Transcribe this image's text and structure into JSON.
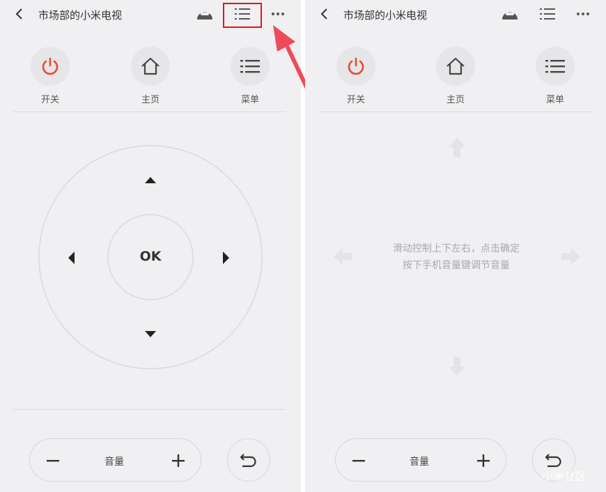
{
  "left_panel": {
    "header": {
      "title": "市场部的小米电视"
    },
    "quick_buttons": [
      {
        "label": "开关"
      },
      {
        "label": "主页"
      },
      {
        "label": "菜单"
      }
    ],
    "dpad": {
      "ok_label": "OK"
    },
    "volume": {
      "label": "音量"
    }
  },
  "right_panel": {
    "header": {
      "title": "市场部的小米电视"
    },
    "quick_buttons": [
      {
        "label": "开关"
      },
      {
        "label": "主页"
      },
      {
        "label": "菜单"
      }
    ],
    "touchpad_hint": {
      "line1": "滑动控制上下左右，点击确定",
      "line2": "按下手机音量键调节音量"
    },
    "volume": {
      "label": "音量"
    }
  },
  "watermark": {
    "text": "小米社区"
  },
  "colors": {
    "background": "#f0eff1",
    "power_accent": "#e8492e",
    "highlight_box": "#d7191f",
    "annotation_arrow": "#ee4a57"
  },
  "icons": [
    "back-icon",
    "remote-icon",
    "list-icon",
    "more-icon",
    "power-icon",
    "home-icon",
    "menu-icon",
    "arrow-up-icon",
    "arrow-down-icon",
    "arrow-left-icon",
    "arrow-right-icon",
    "minus-icon",
    "plus-icon",
    "return-icon"
  ]
}
